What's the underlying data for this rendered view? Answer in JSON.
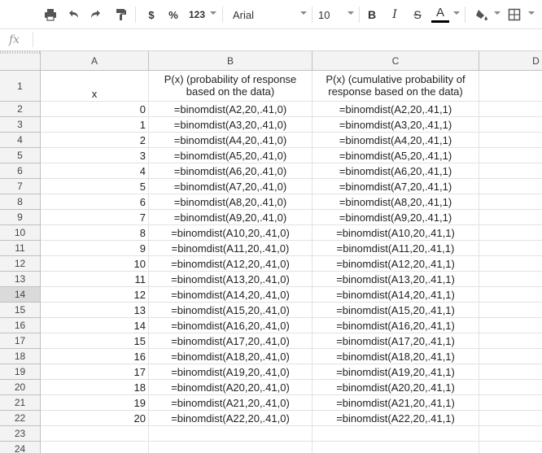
{
  "toolbar": {
    "currency_label": "$",
    "percent_label": "%",
    "number_format_label": "123",
    "font_name": "Arial",
    "font_size": "10",
    "bold_label": "B",
    "italic_label": "I",
    "strike_label": "S",
    "text_color_label": "A",
    "text_color": "#000000"
  },
  "formula_bar": {
    "fx_label": "fx",
    "value": ""
  },
  "columns": [
    "A",
    "B",
    "C",
    "D"
  ],
  "active_row": "14",
  "header_row": {
    "row_label": "1",
    "a": "x",
    "b": "P(x) (probability of response based on the data)",
    "c": "P(x) (cumulative probability of response based on the data)"
  },
  "rows": [
    {
      "row": "2",
      "x": "0",
      "b": "=binomdist(A2,20,.41,0)",
      "c": "=binomdist(A2,20,.41,1)"
    },
    {
      "row": "3",
      "x": "1",
      "b": "=binomdist(A3,20,.41,0)",
      "c": "=binomdist(A3,20,.41,1)"
    },
    {
      "row": "4",
      "x": "2",
      "b": "=binomdist(A4,20,.41,0)",
      "c": "=binomdist(A4,20,.41,1)"
    },
    {
      "row": "5",
      "x": "3",
      "b": "=binomdist(A5,20,.41,0)",
      "c": "=binomdist(A5,20,.41,1)"
    },
    {
      "row": "6",
      "x": "4",
      "b": "=binomdist(A6,20,.41,0)",
      "c": "=binomdist(A6,20,.41,1)"
    },
    {
      "row": "7",
      "x": "5",
      "b": "=binomdist(A7,20,.41,0)",
      "c": "=binomdist(A7,20,.41,1)"
    },
    {
      "row": "8",
      "x": "6",
      "b": "=binomdist(A8,20,.41,0)",
      "c": "=binomdist(A8,20,.41,1)"
    },
    {
      "row": "9",
      "x": "7",
      "b": "=binomdist(A9,20,.41,0)",
      "c": "=binomdist(A9,20,.41,1)"
    },
    {
      "row": "10",
      "x": "8",
      "b": "=binomdist(A10,20,.41,0)",
      "c": "=binomdist(A10,20,.41,1)"
    },
    {
      "row": "11",
      "x": "9",
      "b": "=binomdist(A11,20,.41,0)",
      "c": "=binomdist(A11,20,.41,1)"
    },
    {
      "row": "12",
      "x": "10",
      "b": "=binomdist(A12,20,.41,0)",
      "c": "=binomdist(A12,20,.41,1)"
    },
    {
      "row": "13",
      "x": "11",
      "b": "=binomdist(A13,20,.41,0)",
      "c": "=binomdist(A13,20,.41,1)"
    },
    {
      "row": "14",
      "x": "12",
      "b": "=binomdist(A14,20,.41,0)",
      "c": "=binomdist(A14,20,.41,1)"
    },
    {
      "row": "15",
      "x": "13",
      "b": "=binomdist(A15,20,.41,0)",
      "c": "=binomdist(A15,20,.41,1)"
    },
    {
      "row": "16",
      "x": "14",
      "b": "=binomdist(A16,20,.41,0)",
      "c": "=binomdist(A16,20,.41,1)"
    },
    {
      "row": "17",
      "x": "15",
      "b": "=binomdist(A17,20,.41,0)",
      "c": "=binomdist(A17,20,.41,1)"
    },
    {
      "row": "18",
      "x": "16",
      "b": "=binomdist(A18,20,.41,0)",
      "c": "=binomdist(A18,20,.41,1)"
    },
    {
      "row": "19",
      "x": "17",
      "b": "=binomdist(A19,20,.41,0)",
      "c": "=binomdist(A19,20,.41,1)"
    },
    {
      "row": "20",
      "x": "18",
      "b": "=binomdist(A20,20,.41,0)",
      "c": "=binomdist(A20,20,.41,1)"
    },
    {
      "row": "21",
      "x": "19",
      "b": "=binomdist(A21,20,.41,0)",
      "c": "=binomdist(A21,20,.41,1)"
    },
    {
      "row": "22",
      "x": "20",
      "b": "=binomdist(A22,20,.41,0)",
      "c": "=binomdist(A22,20,.41,1)"
    },
    {
      "row": "23",
      "x": "",
      "b": "",
      "c": ""
    },
    {
      "row": "24",
      "x": "",
      "b": "",
      "c": ""
    }
  ]
}
